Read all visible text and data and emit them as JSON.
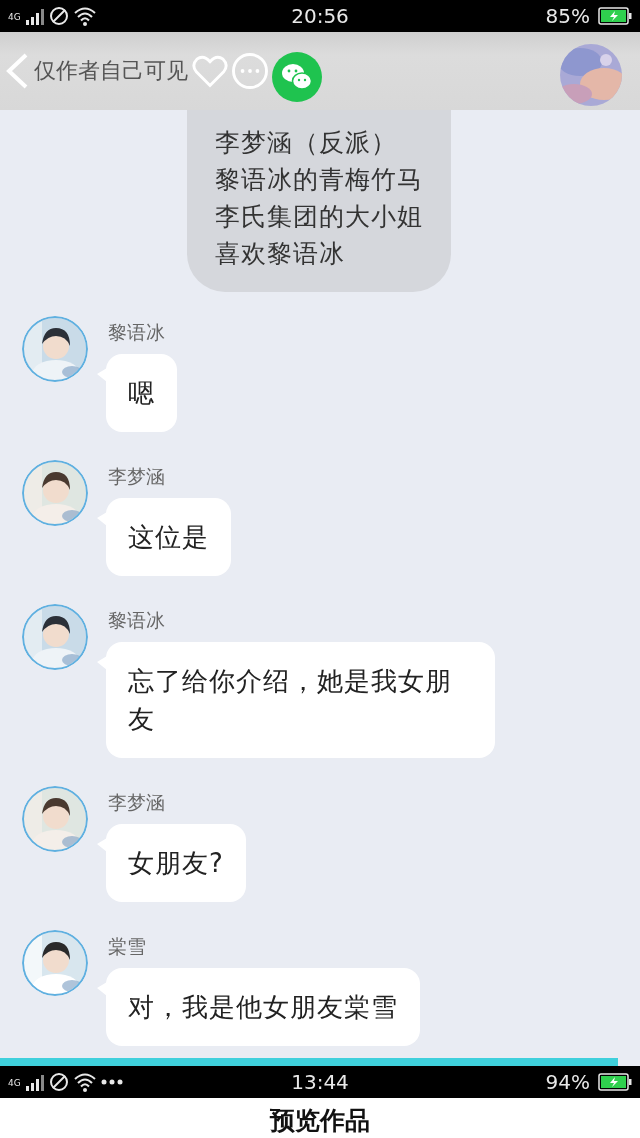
{
  "status_bar": {
    "network": "4G",
    "time": "20:56",
    "battery": "85%"
  },
  "header": {
    "visibility": "仅作者自己可见"
  },
  "narration": [
    "李梦涵（反派）",
    "黎语冰的青梅竹马",
    "李氏集团的大小姐",
    "喜欢黎语冰"
  ],
  "messages": [
    {
      "sender": "黎语冰",
      "text": "嗯"
    },
    {
      "sender": "李梦涵",
      "text": "这位是"
    },
    {
      "sender": "黎语冰",
      "text": "忘了给你介绍，她是我女朋友"
    },
    {
      "sender": "李梦涵",
      "text": "女朋友?"
    },
    {
      "sender": "棠雪",
      "text": "对，我是他女朋友棠雪"
    }
  ],
  "second_status_bar": {
    "network": "4G",
    "time": "13:44",
    "battery": "94%"
  },
  "preview_header": {
    "title": "预览作品"
  }
}
